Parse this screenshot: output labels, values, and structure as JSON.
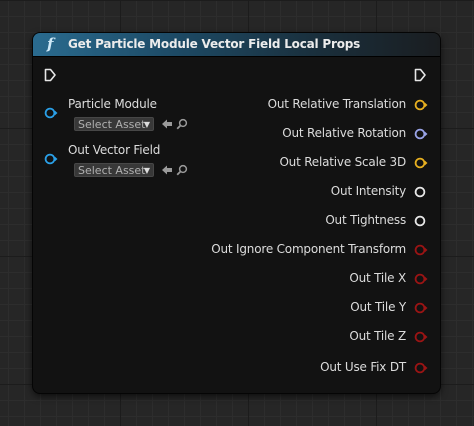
{
  "node": {
    "title": "Get Particle Module Vector Field Local Props",
    "icon": "function-icon",
    "inputs": [
      {
        "label": "Particle Module",
        "asset_placeholder": "Select Asset",
        "color": "#2aa0e8"
      },
      {
        "label": "Out Vector Field",
        "asset_placeholder": "Select Asset",
        "color": "#2aa0e8"
      }
    ],
    "outputs": [
      {
        "label": "Out Relative Translation",
        "color": "#e8b020"
      },
      {
        "label": "Out Relative Rotation",
        "color": "#9aa4e8"
      },
      {
        "label": "Out Relative Scale 3D",
        "color": "#e8b020"
      },
      {
        "label": "Out Intensity",
        "color": "#e8e8e8"
      },
      {
        "label": "Out Tightness",
        "color": "#e8e8e8"
      },
      {
        "label": "Out Ignore Component Transform",
        "color": "#9b1414"
      },
      {
        "label": "Out Tile X",
        "color": "#9b1414"
      },
      {
        "label": "Out Tile Y",
        "color": "#9b1414"
      },
      {
        "label": "Out Tile Z",
        "color": "#9b1414"
      },
      {
        "label": "Out Use Fix DT",
        "color": "#9b1414"
      }
    ]
  }
}
